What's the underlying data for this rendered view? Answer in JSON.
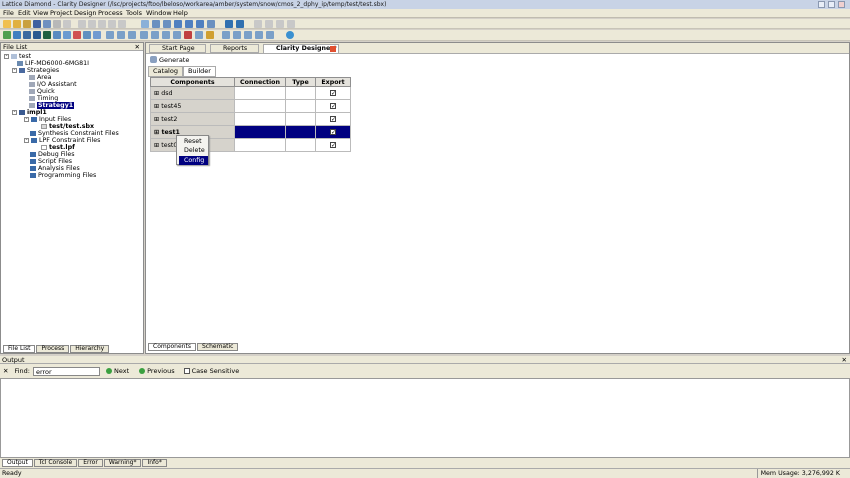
{
  "window": {
    "title": "Lattice Diamond - Clarity Designer (/lsc/projects/ftoo/lbeloso/workarea/amber/system/snow/cmos_2_dphy_ip/temp/test/test.sbx)"
  },
  "menu": [
    "File",
    "Edit",
    "View",
    "Project",
    "Design",
    "Process",
    "Tools",
    "Window",
    "Help"
  ],
  "file_list": {
    "header": "File List",
    "tree": {
      "root": "test",
      "device": "LIF-MD6000-6MG81I",
      "strategies": "Strategies",
      "strategy_items": [
        "Area",
        "I/O Assistant",
        "Quick",
        "Timing",
        "Strategy1"
      ],
      "impl": "impl1",
      "input_files": "Input Files",
      "sbx_file": "test/test.sbx",
      "synth_constraint": "Synthesis Constraint Files",
      "lpf_constraint": "LPF Constraint Files",
      "lpf_file": "test.lpf",
      "debug": "Debug Files",
      "script": "Script Files",
      "analysis": "Analysis Files",
      "programming": "Programming Files"
    },
    "tabs": [
      "File List",
      "Process",
      "Hierarchy"
    ]
  },
  "doc_tabs": [
    "Start Page",
    "Reports",
    "Clarity Designer*"
  ],
  "generate_label": "Generate",
  "sub_tabs": [
    "Catalog",
    "Builder"
  ],
  "table": {
    "columns": [
      "Components",
      "Connection",
      "Type",
      "Export"
    ],
    "rows": [
      {
        "name": "dsd",
        "export": "✓"
      },
      {
        "name": "test45",
        "export": "✓"
      },
      {
        "name": "test2",
        "export": "✓"
      },
      {
        "name": "test1",
        "export": "✓"
      },
      {
        "name": "test0",
        "export": "✓"
      }
    ]
  },
  "context_menu": [
    "Reset",
    "Delete",
    "Config"
  ],
  "view_tabs": [
    "Components",
    "Schematic"
  ],
  "output": {
    "header": "Output",
    "find_label": "Find:",
    "find_value": "error",
    "next": "Next",
    "previous": "Previous",
    "case": "Case Sensitive",
    "tabs": [
      "Output",
      "Tcl Console",
      "Error",
      "Warning*",
      "Info*"
    ]
  },
  "status": {
    "left": "Ready",
    "mem": "Mem Usage: 3,276,992 K"
  },
  "colors": {
    "selection": "#000080",
    "background": "#d4d0c8"
  }
}
